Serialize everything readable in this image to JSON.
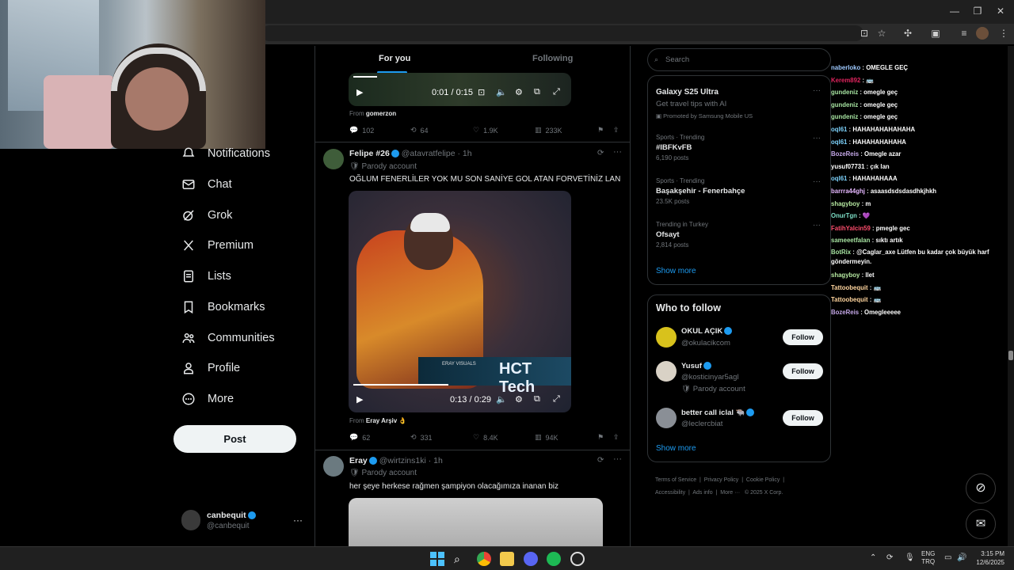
{
  "nav": {
    "items": [
      {
        "label": "Notifications",
        "icon": "bell-icon"
      },
      {
        "label": "Chat",
        "icon": "envelope-icon"
      },
      {
        "label": "Grok",
        "icon": "grok-icon"
      },
      {
        "label": "Premium",
        "icon": "x-logo-icon"
      },
      {
        "label": "Lists",
        "icon": "list-icon"
      },
      {
        "label": "Bookmarks",
        "icon": "bookmark-icon"
      },
      {
        "label": "Communities",
        "icon": "people-icon"
      },
      {
        "label": "Profile",
        "icon": "person-icon"
      },
      {
        "label": "More",
        "icon": "more-circle-icon"
      }
    ],
    "post_label": "Post",
    "account": {
      "name": "canbequit",
      "handle": "@canbequit"
    }
  },
  "feed": {
    "tabs": [
      "For you",
      "Following"
    ],
    "post0": {
      "time": "0:01 / 0:15",
      "from_prefix": "From",
      "from": "gomerzon",
      "stats": [
        "102",
        "64",
        "1.9K",
        "233K"
      ]
    },
    "post1": {
      "name": "Felipe #26",
      "handle": "@atavratfelipe · 1h",
      "badge": "Parody account",
      "text": "OĞLUM FENERLİLER YOK MU SON SANİYE GOL ATAN FORVETİNİZ LAN",
      "video_overlay": "ERAY VISUALS",
      "video_brand": "HCT Tech",
      "time": "0:13 / 0:29",
      "from_prefix": "From",
      "from": "Eray Arşiv 👌",
      "stats": [
        "62",
        "331",
        "8.4K",
        "94K"
      ]
    },
    "post2": {
      "name": "Eray",
      "handle": "@wirtzins1ki · 1h",
      "badge": "Parody account",
      "text": "her şeye herkese rağmen şampiyon olacağımıza inanan biz"
    }
  },
  "right": {
    "search_placeholder": "Search",
    "promo": {
      "name": "Galaxy S25 Ultra",
      "desc": "Get travel tips with AI",
      "promoted": "Promoted by Samsung Mobile US"
    },
    "trends": [
      {
        "cat": "Sports · Trending",
        "name": "#IBFKvFB",
        "count": "6,190 posts"
      },
      {
        "cat": "Sports · Trending",
        "name": "Başakşehir - Fenerbahçe",
        "count": "23.5K posts"
      },
      {
        "cat": "Trending in Turkey",
        "name": "Ofsayt",
        "count": "2,814 posts"
      }
    ],
    "show_more": "Show more",
    "wtf_title": "Who to follow",
    "wtf": [
      {
        "name": "OKUL AÇIK",
        "handle": "@okulacikcom",
        "badge": ""
      },
      {
        "name": "Yusuf",
        "handle": "@kosticinyar5agl",
        "badge": "Parody account"
      },
      {
        "name": "better call iclal 🐃",
        "handle": "@leclercbiat",
        "badge": ""
      }
    ],
    "follow_label": "Follow",
    "footer": [
      "Terms of Service",
      "Privacy Policy",
      "Cookie Policy",
      "Accessibility",
      "Ads info",
      "More ···",
      "© 2025 X Corp."
    ]
  },
  "chat": [
    {
      "user": "naberloko",
      "msg": "OMEGLE GEÇ",
      "color": "#9ec9ff"
    },
    {
      "user": "Kerem892",
      "msg": "🚌",
      "color": "#e0245e"
    },
    {
      "user": "gundeniz",
      "msg": "omegle geç",
      "color": "#a6e3a1"
    },
    {
      "user": "gundeniz",
      "msg": "omegle geç",
      "color": "#a6e3a1"
    },
    {
      "user": "gundeniz",
      "msg": "omegle geç",
      "color": "#a6e3a1"
    },
    {
      "user": "oql61",
      "msg": "HAHAHAHAHAHAHA",
      "color": "#7dd3fc"
    },
    {
      "user": "oql61",
      "msg": "HAHAHAHAHAHA",
      "color": "#7dd3fc"
    },
    {
      "user": "BozeReis",
      "msg": "Omegle azar",
      "color": "#c4a7e7"
    },
    {
      "user": "yusuf07731",
      "msg": "çık lan",
      "color": "#ffffff"
    },
    {
      "user": "oql61",
      "msg": "HAHAHAHAAA",
      "color": "#7dd3fc"
    },
    {
      "user": "barrra44ghj",
      "msg": "asaasdsdsdasdhkjhkh",
      "color": "#e6b8ff"
    },
    {
      "user": "shagyboy",
      "msg": "m",
      "color": "#b5e8a1"
    },
    {
      "user": "OnurTgn",
      "msg": "💜",
      "color": "#7ee0c8"
    },
    {
      "user": "FatihYalcin59",
      "msg": "pmegle gec",
      "color": "#ff4d6d"
    },
    {
      "user": "sameeetfalan",
      "msg": "sıktı artık",
      "color": "#a6e3a1"
    },
    {
      "user": "BotRix",
      "msg": "@Caglar_axe Lütfen bu kadar çok büyük harf göndermeyin.",
      "color": "#a6e3a1"
    },
    {
      "user": "shagyboy",
      "msg": "llet",
      "color": "#b5e8a1"
    },
    {
      "user": "Tattoobequit",
      "msg": "🚌",
      "color": "#ffd59e"
    },
    {
      "user": "Tattoobequit",
      "msg": "🚌",
      "color": "#ffd59e"
    },
    {
      "user": "BozeReis",
      "msg": "Omegleeeee",
      "color": "#c4a7e7"
    }
  ],
  "taskbar": {
    "lang1": "ENG",
    "lang2": "TRQ",
    "time": "3:15 PM",
    "date": "12/6/2025"
  }
}
